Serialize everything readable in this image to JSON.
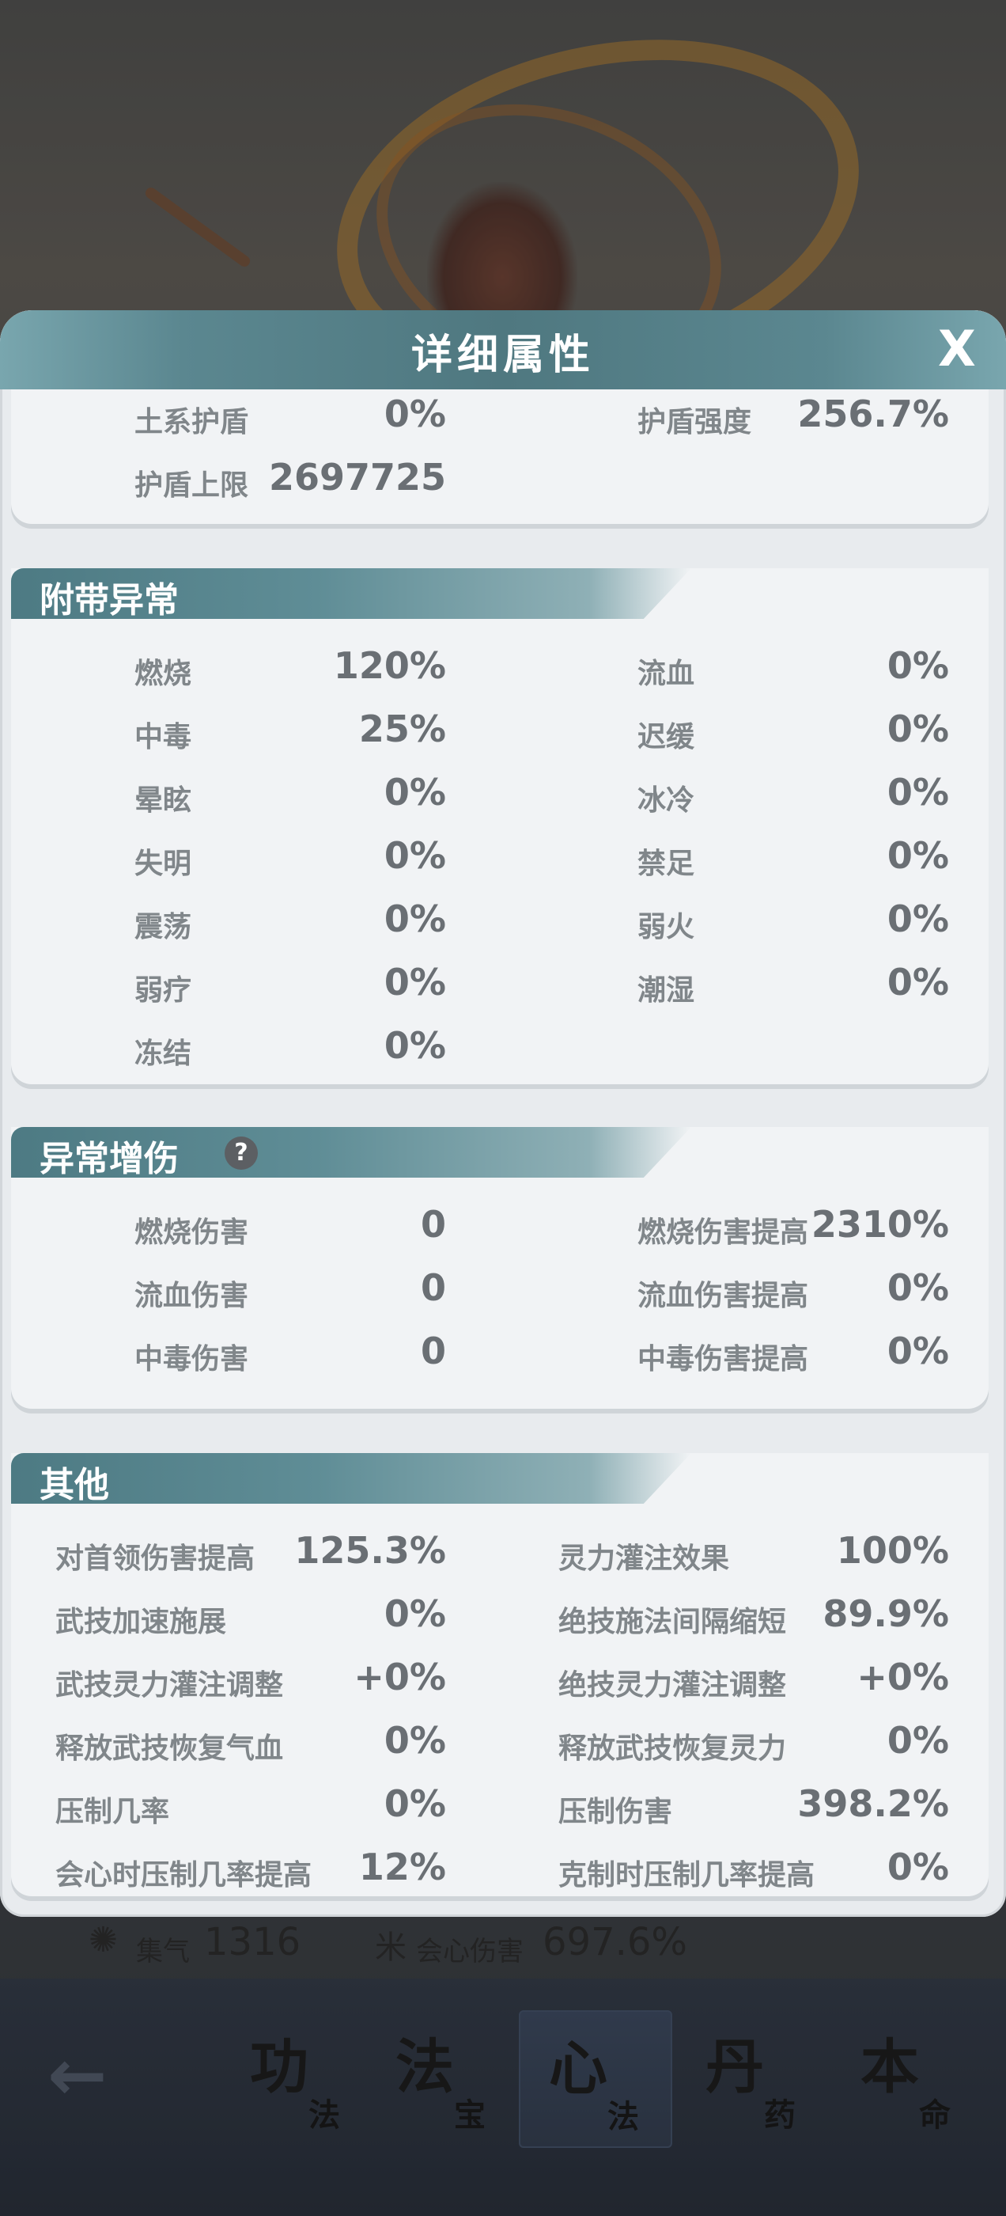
{
  "panel": {
    "title": "详细属性",
    "close_label": "X"
  },
  "shield": {
    "rows": [
      {
        "label": "土系护盾",
        "value": "0%"
      },
      {
        "label": "护盾强度",
        "value": "256.7%"
      },
      {
        "label": "护盾上限",
        "value": "2697725"
      }
    ]
  },
  "status": {
    "title": "附带异常",
    "rows": [
      {
        "label": "燃烧",
        "value": "120%"
      },
      {
        "label": "流血",
        "value": "0%"
      },
      {
        "label": "中毒",
        "value": "25%"
      },
      {
        "label": "迟缓",
        "value": "0%"
      },
      {
        "label": "晕眩",
        "value": "0%"
      },
      {
        "label": "冰冷",
        "value": "0%"
      },
      {
        "label": "失明",
        "value": "0%"
      },
      {
        "label": "禁足",
        "value": "0%"
      },
      {
        "label": "震荡",
        "value": "0%"
      },
      {
        "label": "弱火",
        "value": "0%"
      },
      {
        "label": "弱疗",
        "value": "0%"
      },
      {
        "label": "潮湿",
        "value": "0%"
      },
      {
        "label": "冻结",
        "value": "0%"
      }
    ]
  },
  "dot": {
    "title": "异常增伤",
    "help": "?",
    "rows": [
      {
        "label": "燃烧伤害",
        "value": "0"
      },
      {
        "label": "燃烧伤害提高",
        "value": "2310%"
      },
      {
        "label": "流血伤害",
        "value": "0"
      },
      {
        "label": "流血伤害提高",
        "value": "0%"
      },
      {
        "label": "中毒伤害",
        "value": "0"
      },
      {
        "label": "中毒伤害提高",
        "value": "0%"
      }
    ]
  },
  "other": {
    "title": "其他",
    "rows": [
      {
        "label": "对首领伤害提高",
        "value": "125.3%"
      },
      {
        "label": "灵力灌注效果",
        "value": "100%"
      },
      {
        "label": "武技加速施展",
        "value": "0%"
      },
      {
        "label": "绝技施法间隔缩短",
        "value": "89.9%"
      },
      {
        "label": "武技灵力灌注调整",
        "value": "+0%"
      },
      {
        "label": "绝技灵力灌注调整",
        "value": "+0%"
      },
      {
        "label": "释放武技恢复气血",
        "value": "0%"
      },
      {
        "label": "释放武技恢复灵力",
        "value": "0%"
      },
      {
        "label": "压制几率",
        "value": "0%"
      },
      {
        "label": "压制伤害",
        "value": "398.2%"
      },
      {
        "label": "会心时压制几率提高",
        "value": "12%"
      },
      {
        "label": "克制时压制几率提高",
        "value": "0%"
      }
    ]
  },
  "peek": {
    "a_icon": "✺",
    "a_label": "集气",
    "a_value": "1316",
    "b_icon": "米",
    "b_label": "会心伤害",
    "b_value": "697.6%"
  },
  "nav": {
    "back_icon": "arrow-left-icon",
    "back_glyph": "←",
    "tabs": [
      {
        "big": "功",
        "small": "法"
      },
      {
        "big": "法",
        "small": "宝"
      },
      {
        "big": "心",
        "small": "法",
        "active": true
      },
      {
        "big": "丹",
        "small": "药"
      },
      {
        "big": "本",
        "small": "命"
      }
    ]
  }
}
